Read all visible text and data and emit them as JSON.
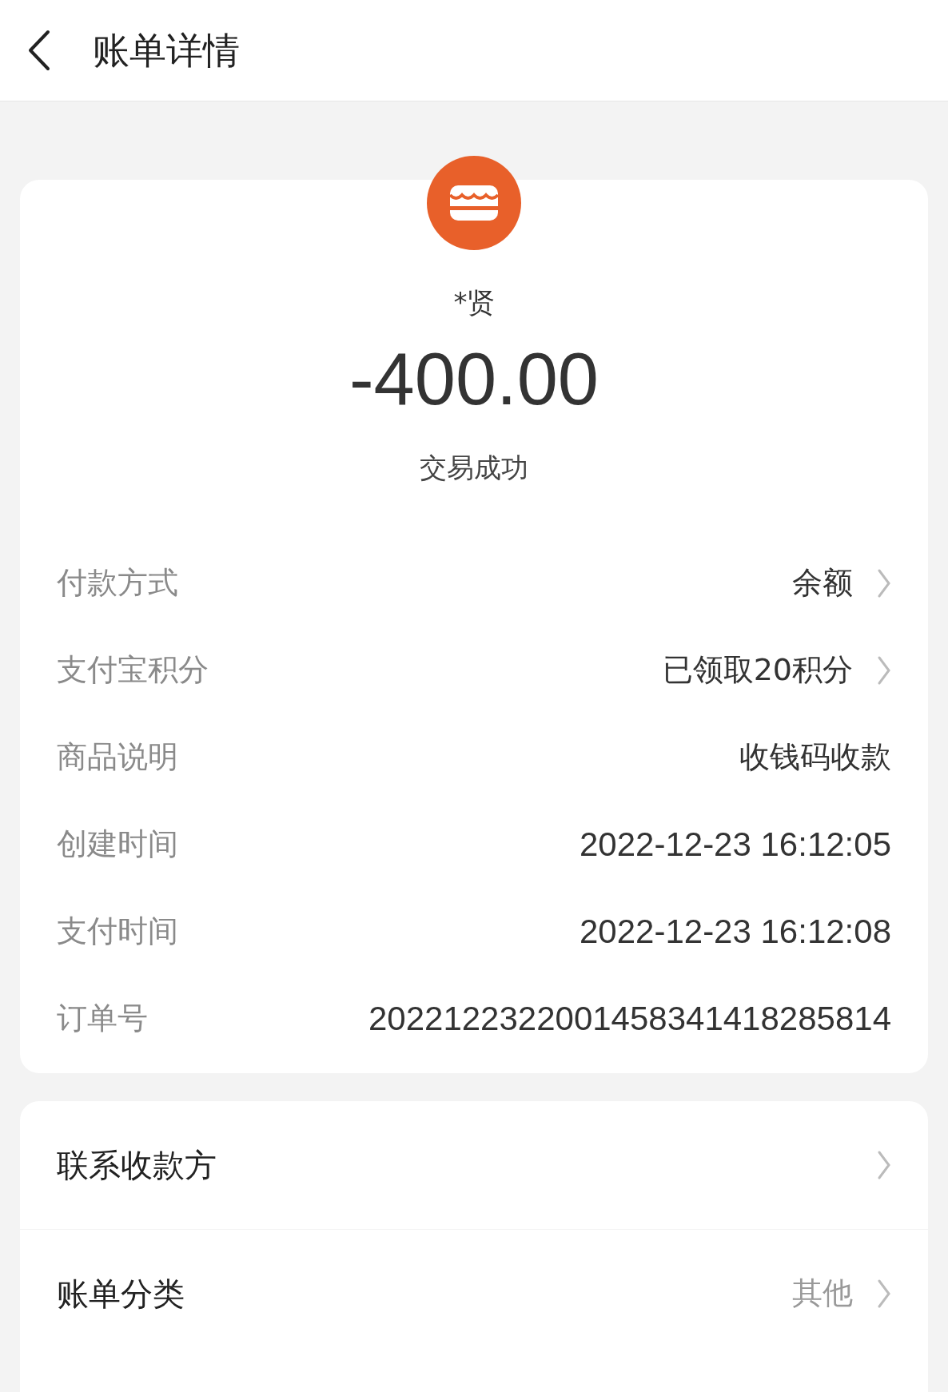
{
  "header": {
    "title": "账单详情"
  },
  "summary": {
    "payee": "*贤",
    "amount": "-400.00",
    "status": "交易成功"
  },
  "details": [
    {
      "label": "付款方式",
      "value": "余额",
      "chevron": true
    },
    {
      "label": "支付宝积分",
      "value": "已领取20积分",
      "chevron": true
    },
    {
      "label": "商品说明",
      "value": "收钱码收款",
      "chevron": false
    },
    {
      "label": "创建时间",
      "value": "2022-12-23 16:12:05",
      "chevron": false
    },
    {
      "label": "支付时间",
      "value": "2022-12-23 16:12:08",
      "chevron": false
    },
    {
      "label": "订单号",
      "value": "2022122322001458341418285814",
      "chevron": false
    }
  ],
  "actions": [
    {
      "label": "联系收款方"
    },
    {
      "label": "账单分类",
      "value": "其他"
    }
  ]
}
